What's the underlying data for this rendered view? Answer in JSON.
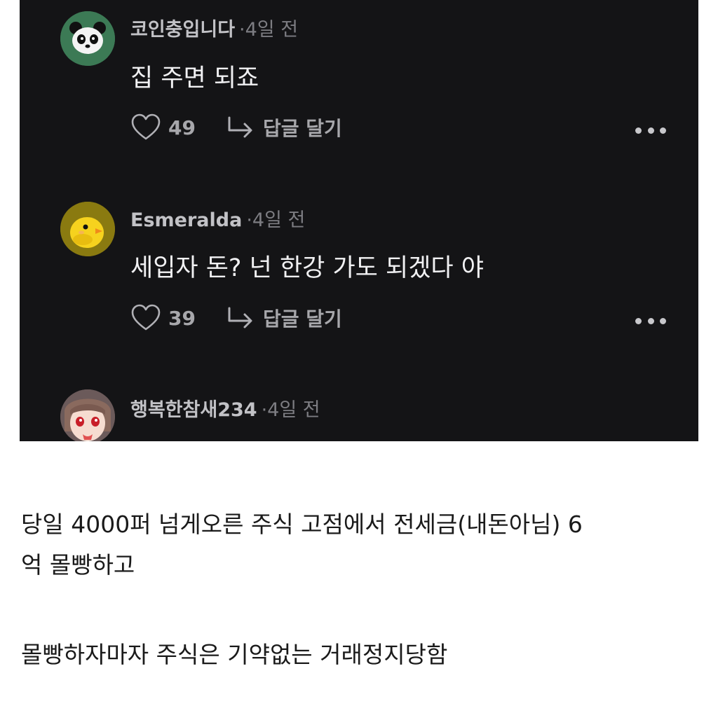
{
  "comments": [
    {
      "author": "코인충입니다",
      "time": "·4일 전",
      "text": "집 주면 되죠",
      "likes": "49",
      "reply_label": "답글 달기",
      "avatar_icon": "panda-avatar",
      "avatar_bg": "#3c7a55"
    },
    {
      "author": "Esmeralda",
      "time": "·4일 전",
      "text": "세입자 돈? 넌 한강 가도 되겠다 야",
      "likes": "39",
      "reply_label": "답글 달기",
      "avatar_icon": "chick-avatar",
      "avatar_bg": "#8a7a10"
    },
    {
      "author": "행복한참새234",
      "time": "·4일 전",
      "avatar_icon": "anime-girl-avatar",
      "avatar_bg": "#6b5a5a"
    }
  ],
  "article": {
    "paragraph1_line1": "당일 4000퍼 넘게오른 주식 고점에서 전세금(내돈아님) 6",
    "paragraph1_line2": "억 몰빵하고",
    "paragraph2": "몰빵하자마자 주식은 기약없는 거래정지당함"
  }
}
